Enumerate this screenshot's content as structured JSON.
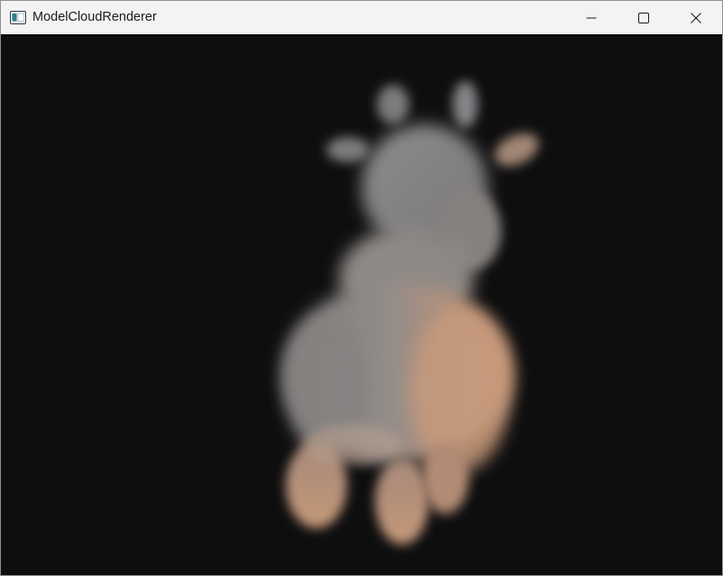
{
  "window": {
    "title": "ModelCloudRenderer",
    "controls": {
      "minimize_icon": "minimize-icon",
      "maximize_icon": "maximize-icon",
      "close_icon": "close-icon"
    }
  },
  "viewport": {
    "background_color": "#0e0e0f",
    "render_subject": "blurred-point-cloud-cow-model",
    "colors": {
      "warm_tone": "#c39a7e",
      "cool_tone": "#8b8b8e",
      "peach_tone": "#d7a784"
    }
  }
}
